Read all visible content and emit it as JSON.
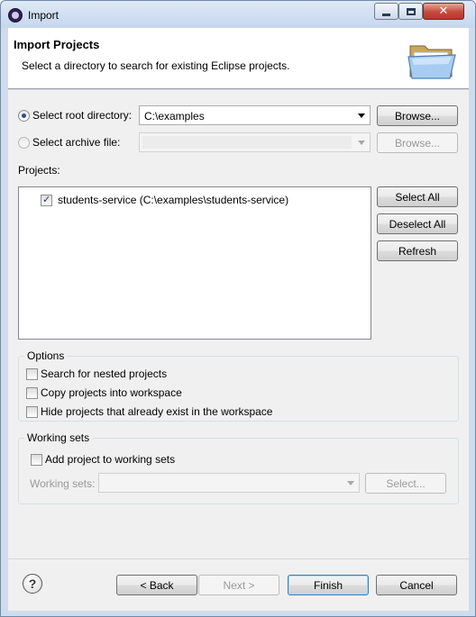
{
  "window": {
    "title": "Import",
    "icons": {
      "app": "eclipse-icon",
      "minimize": "minimize-icon",
      "maximize": "maximize-icon",
      "close": "close-icon"
    }
  },
  "header": {
    "title": "Import Projects",
    "description": "Select a directory to search for existing Eclipse projects.",
    "icon": "open-folder-icon"
  },
  "source": {
    "root_label": "Select root directory:",
    "root_value": "C:\\examples",
    "root_browse": "Browse...",
    "archive_label": "Select archive file:",
    "archive_value": "",
    "archive_browse": "Browse...",
    "selected": "root"
  },
  "projects": {
    "label": "Projects:",
    "items": [
      {
        "label": "students-service (C:\\examples\\students-service)",
        "checked": true
      }
    ],
    "select_all": "Select All",
    "deselect_all": "Deselect All",
    "refresh": "Refresh"
  },
  "options": {
    "title": "Options",
    "items": [
      {
        "label": "Search for nested projects",
        "checked": false
      },
      {
        "label": "Copy projects into workspace",
        "checked": false
      },
      {
        "label": "Hide projects that already exist in the workspace",
        "checked": false
      }
    ]
  },
  "working_sets": {
    "title": "Working sets",
    "add_label": "Add project to working sets",
    "add_checked": false,
    "sets_label": "Working sets:",
    "sets_value": "",
    "select_button": "Select..."
  },
  "footer": {
    "help_icon": "help-icon",
    "back": "< Back",
    "next": "Next >",
    "finish": "Finish",
    "cancel": "Cancel"
  }
}
